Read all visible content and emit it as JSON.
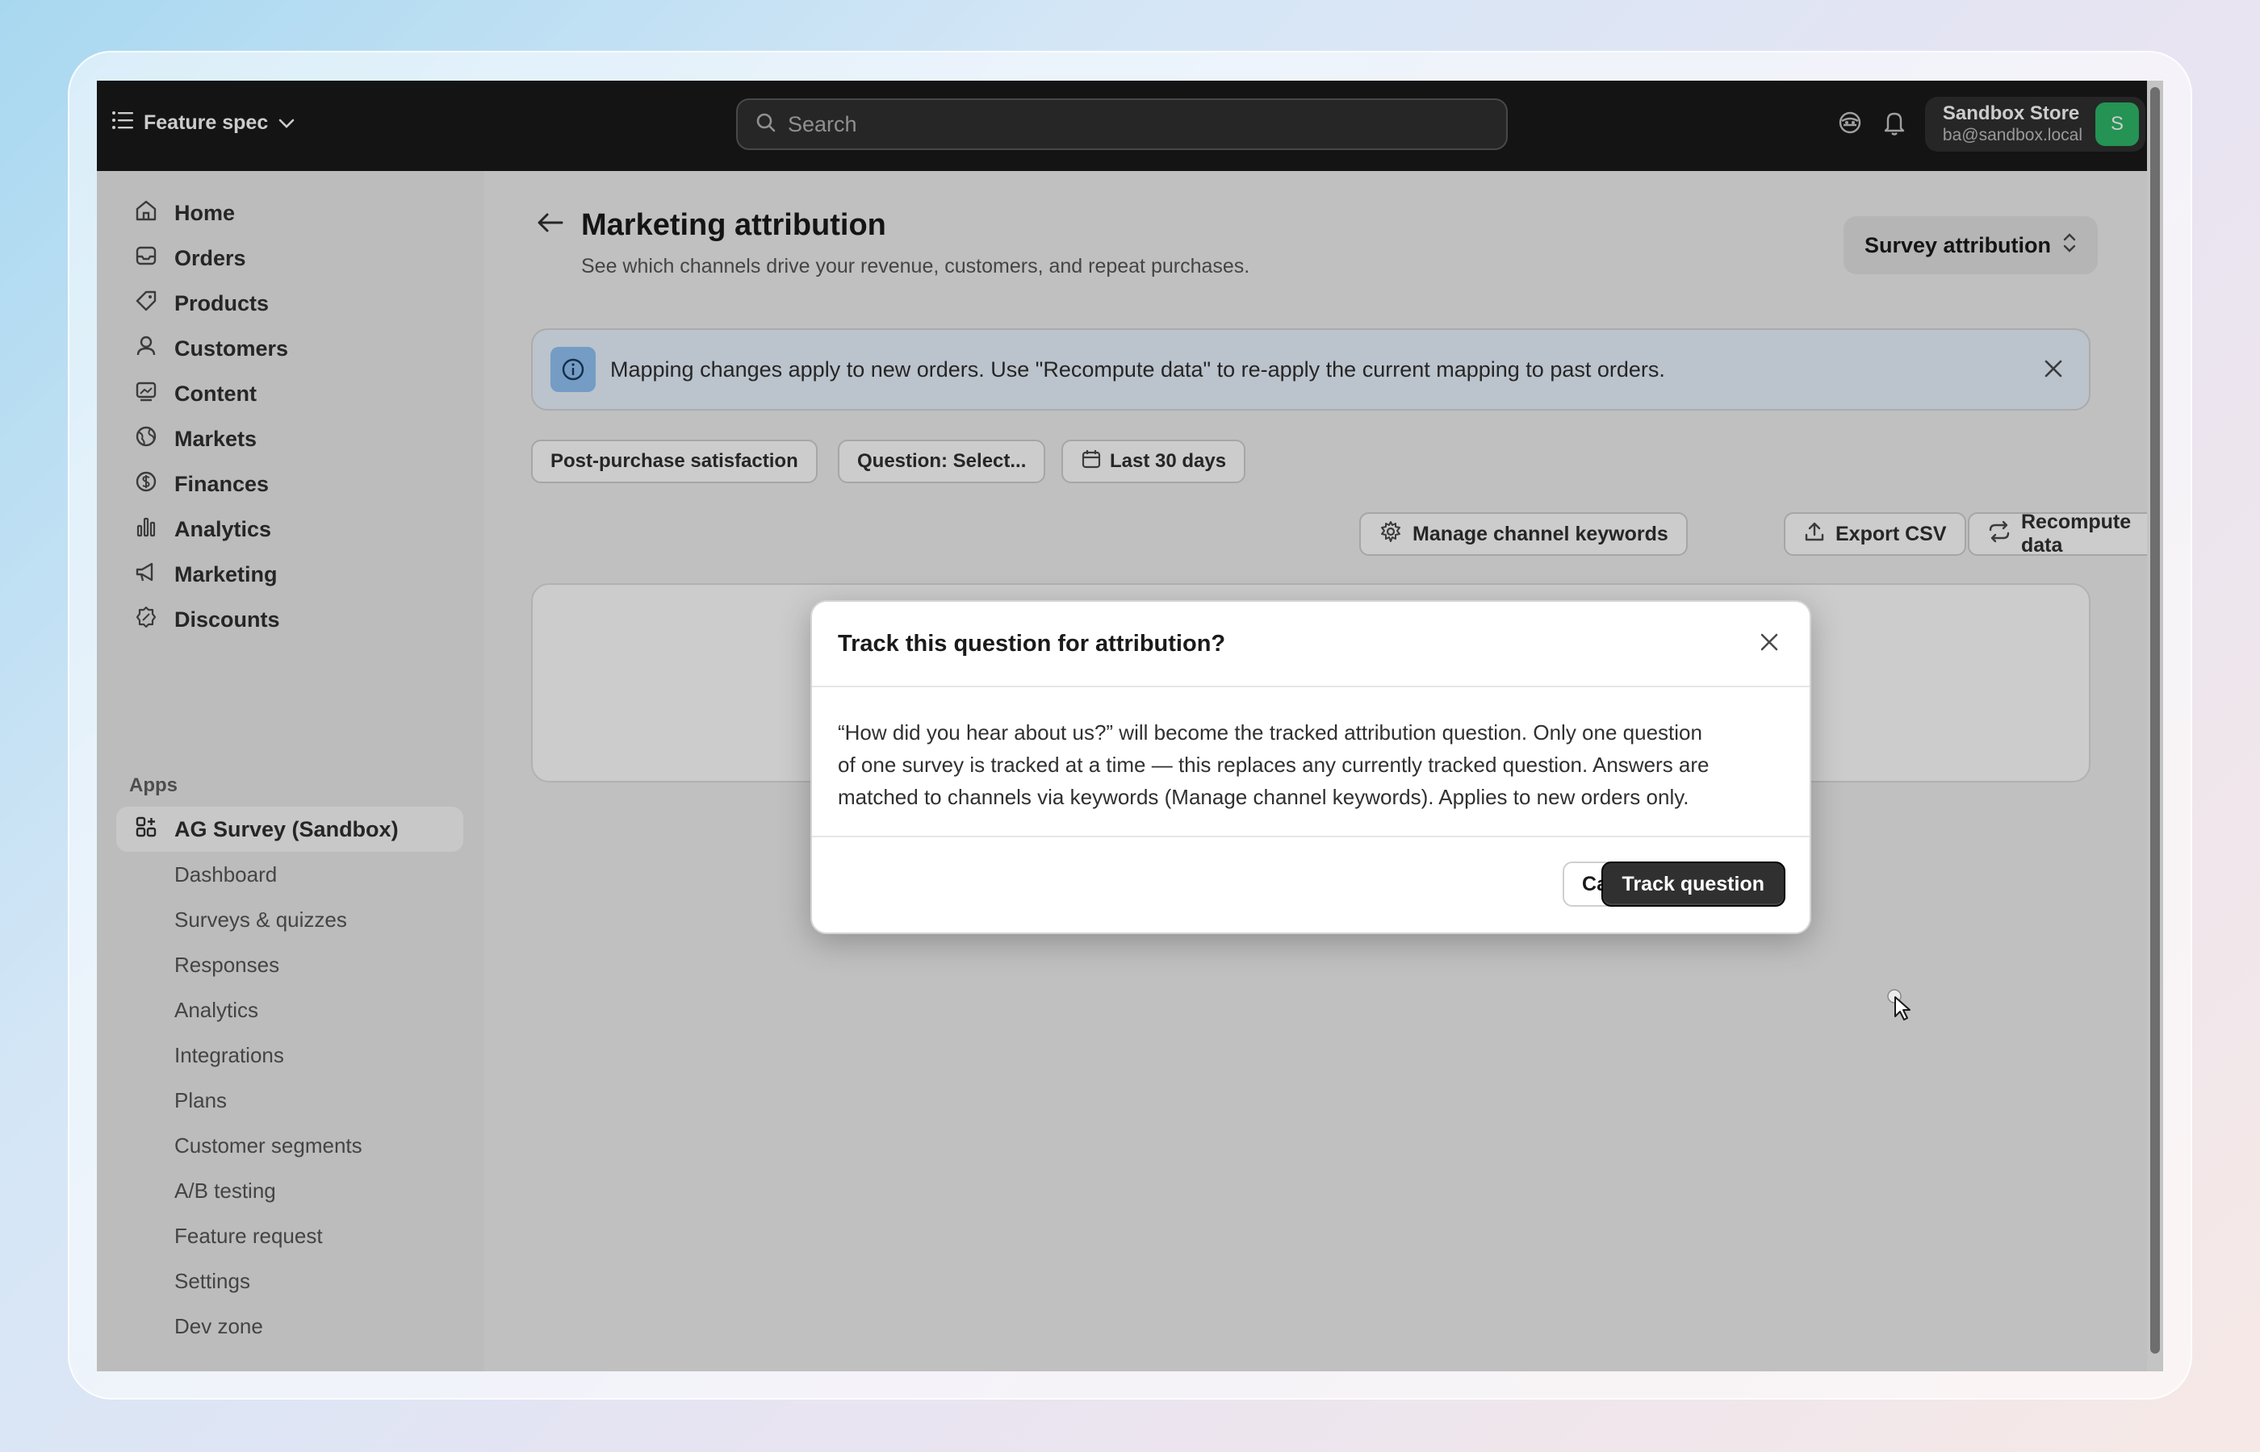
{
  "topbar": {
    "app_switcher_label": "Feature spec",
    "search_placeholder": "Search",
    "store_name": "Sandbox Store",
    "store_email": "ba@sandbox.local",
    "avatar_initial": "S"
  },
  "sidebar": {
    "items": [
      {
        "label": "Home",
        "icon": "home-icon"
      },
      {
        "label": "Orders",
        "icon": "inbox-icon"
      },
      {
        "label": "Products",
        "icon": "tag-icon"
      },
      {
        "label": "Customers",
        "icon": "person-icon"
      },
      {
        "label": "Content",
        "icon": "image-icon"
      },
      {
        "label": "Markets",
        "icon": "globe-icon"
      },
      {
        "label": "Finances",
        "icon": "dollar-icon"
      },
      {
        "label": "Analytics",
        "icon": "bar-chart-icon"
      },
      {
        "label": "Marketing",
        "icon": "megaphone-icon"
      },
      {
        "label": "Discounts",
        "icon": "discount-icon"
      }
    ],
    "apps_label": "Apps",
    "active_app": "AG Survey (Sandbox)",
    "app_subitems": [
      "Dashboard",
      "Surveys & quizzes",
      "Responses",
      "Analytics",
      "Integrations",
      "Plans",
      "Customer segments",
      "A/B testing",
      "Feature request",
      "Settings",
      "Dev zone"
    ]
  },
  "page": {
    "title": "Marketing attribution",
    "subtitle": "See which channels drive your revenue, customers, and repeat purchases.",
    "mode_select": "Survey attribution",
    "banner_text": "Mapping changes apply to new orders. Use \"Recompute data\" to re-apply the current mapping to past orders.",
    "filters": {
      "survey": "Post-purchase satisfaction",
      "question": "Question: Select...",
      "date_range": "Last 30 days"
    },
    "actions": {
      "manage": "Manage channel keywords",
      "export": "Export CSV",
      "recompute": "Recompute data"
    }
  },
  "modal": {
    "title": "Track this question for attribution?",
    "body_line1": "“How did you hear about us?” will become the tracked attribution question. Only one question",
    "body_line2": "of one survey is tracked at a time — this replaces any currently tracked question. Answers are",
    "body_line3": "matched to channels via keywords (Manage channel keywords). Applies to new orders only.",
    "cancel_label": "Cancel",
    "confirm_label": "Track question"
  },
  "colors": {
    "topbar": "#1a1a1a",
    "avatar": "#2db86a",
    "primary_button": "#303030",
    "info_icon_bg": "#91c3f5"
  }
}
